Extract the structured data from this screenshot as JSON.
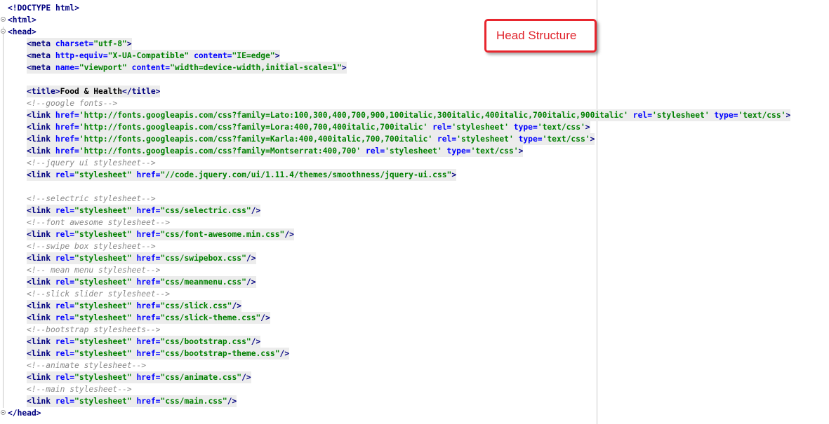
{
  "callout": {
    "label": "Head Structure",
    "border_color": "#e8262e",
    "text_color": "#e0242c"
  },
  "colors": {
    "tag": "#000080",
    "attribute": "#0000ff",
    "value": "#008000",
    "comment": "#8a8a8a",
    "current_line_bg": "#ececec"
  },
  "lines": [
    {
      "indent": 0,
      "fold": false,
      "highlight": false,
      "tokens": [
        [
          "doctype",
          "<!DOCTYPE "
        ],
        [
          "tag",
          "html"
        ],
        [
          "punc",
          ">"
        ]
      ]
    },
    {
      "indent": 0,
      "fold": true,
      "highlight": false,
      "tokens": [
        [
          "tag",
          "<html>"
        ]
      ]
    },
    {
      "indent": 0,
      "fold": true,
      "highlight": false,
      "tokens": [
        [
          "tag",
          "<head>"
        ]
      ]
    },
    {
      "indent": 1,
      "fold": false,
      "highlight": true,
      "tokens": [
        [
          "tag",
          "<meta "
        ],
        [
          "attr",
          "charset="
        ],
        [
          "val",
          "\"utf-8\""
        ],
        [
          "tag",
          ">"
        ]
      ]
    },
    {
      "indent": 1,
      "fold": false,
      "highlight": true,
      "tokens": [
        [
          "tag",
          "<meta "
        ],
        [
          "attr",
          "http-equiv="
        ],
        [
          "val",
          "\"X-UA-Compatible\""
        ],
        [
          "attr",
          " content="
        ],
        [
          "val",
          "\"IE=edge\""
        ],
        [
          "tag",
          ">"
        ]
      ]
    },
    {
      "indent": 1,
      "fold": false,
      "highlight": true,
      "tokens": [
        [
          "tag",
          "<meta "
        ],
        [
          "attr",
          "name="
        ],
        [
          "val",
          "\"viewport\""
        ],
        [
          "attr",
          " content="
        ],
        [
          "val",
          "\"width=device-width,initial-scale=1\""
        ],
        [
          "tag",
          ">"
        ]
      ]
    },
    {
      "indent": 1,
      "fold": false,
      "highlight": false,
      "tokens": []
    },
    {
      "indent": 1,
      "fold": false,
      "highlight": true,
      "tokens": [
        [
          "tag",
          "<title>"
        ],
        [
          "txt",
          "Food & Health"
        ],
        [
          "tag",
          "</title>"
        ]
      ]
    },
    {
      "indent": 1,
      "fold": false,
      "highlight": false,
      "tokens": [
        [
          "cmt",
          "<!--google fonts-->"
        ]
      ]
    },
    {
      "indent": 1,
      "fold": false,
      "highlight": true,
      "tokens": [
        [
          "tag",
          "<link "
        ],
        [
          "attr",
          "href="
        ],
        [
          "val",
          "'http://fonts.googleapis.com/css?family=Lato:100,300,400,700,900,100italic,300italic,400italic,700italic,900italic'"
        ],
        [
          "attr",
          " rel="
        ],
        [
          "val",
          "'stylesheet'"
        ],
        [
          "attr",
          " type="
        ],
        [
          "val",
          "'text/css'"
        ],
        [
          "tag",
          ">"
        ]
      ]
    },
    {
      "indent": 1,
      "fold": false,
      "highlight": true,
      "tokens": [
        [
          "tag",
          "<link "
        ],
        [
          "attr",
          "href="
        ],
        [
          "val",
          "'http://fonts.googleapis.com/css?family=Lora:400,700,400italic,700italic'"
        ],
        [
          "attr",
          " rel="
        ],
        [
          "val",
          "'stylesheet'"
        ],
        [
          "attr",
          " type="
        ],
        [
          "val",
          "'text/css'"
        ],
        [
          "tag",
          ">"
        ]
      ]
    },
    {
      "indent": 1,
      "fold": false,
      "highlight": true,
      "tokens": [
        [
          "tag",
          "<link "
        ],
        [
          "attr",
          "href="
        ],
        [
          "val",
          "'http://fonts.googleapis.com/css?family=Karla:400,400italic,700,700italic'"
        ],
        [
          "attr",
          " rel="
        ],
        [
          "val",
          "'stylesheet'"
        ],
        [
          "attr",
          " type="
        ],
        [
          "val",
          "'text/css'"
        ],
        [
          "tag",
          ">"
        ]
      ]
    },
    {
      "indent": 1,
      "fold": false,
      "highlight": true,
      "tokens": [
        [
          "tag",
          "<link "
        ],
        [
          "attr",
          "href="
        ],
        [
          "val",
          "'http://fonts.googleapis.com/css?family=Montserrat:400,700'"
        ],
        [
          "attr",
          " rel="
        ],
        [
          "val",
          "'stylesheet'"
        ],
        [
          "attr",
          " type="
        ],
        [
          "val",
          "'text/css'"
        ],
        [
          "tag",
          ">"
        ]
      ]
    },
    {
      "indent": 1,
      "fold": false,
      "highlight": false,
      "tokens": [
        [
          "cmt",
          "<!--jquery ui stylesheet-->"
        ]
      ]
    },
    {
      "indent": 1,
      "fold": false,
      "highlight": true,
      "tokens": [
        [
          "tag",
          "<link "
        ],
        [
          "attr",
          "rel="
        ],
        [
          "val",
          "\"stylesheet\""
        ],
        [
          "attr",
          " href="
        ],
        [
          "val",
          "\"//code.jquery.com/ui/1.11.4/themes/smoothness/jquery-ui.css\""
        ],
        [
          "tag",
          ">"
        ]
      ]
    },
    {
      "indent": 1,
      "fold": false,
      "highlight": false,
      "tokens": []
    },
    {
      "indent": 1,
      "fold": false,
      "highlight": false,
      "tokens": [
        [
          "cmt",
          "<!--selectric stylesheet-->"
        ]
      ]
    },
    {
      "indent": 1,
      "fold": false,
      "highlight": true,
      "tokens": [
        [
          "tag",
          "<link "
        ],
        [
          "attr",
          "rel="
        ],
        [
          "val",
          "\"stylesheet\""
        ],
        [
          "attr",
          " href="
        ],
        [
          "val",
          "\"css/selectric.css\""
        ],
        [
          "tag",
          "/>"
        ]
      ]
    },
    {
      "indent": 1,
      "fold": false,
      "highlight": false,
      "tokens": [
        [
          "cmt",
          "<!--font awesome stylesheet-->"
        ]
      ]
    },
    {
      "indent": 1,
      "fold": false,
      "highlight": true,
      "tokens": [
        [
          "tag",
          "<link "
        ],
        [
          "attr",
          "rel="
        ],
        [
          "val",
          "\"stylesheet\""
        ],
        [
          "attr",
          " href="
        ],
        [
          "val",
          "\"css/font-awesome.min.css\""
        ],
        [
          "tag",
          "/>"
        ]
      ]
    },
    {
      "indent": 1,
      "fold": false,
      "highlight": false,
      "tokens": [
        [
          "cmt",
          "<!--swipe box stylesheet-->"
        ]
      ]
    },
    {
      "indent": 1,
      "fold": false,
      "highlight": true,
      "tokens": [
        [
          "tag",
          "<link "
        ],
        [
          "attr",
          "rel="
        ],
        [
          "val",
          "\"stylesheet\""
        ],
        [
          "attr",
          " href="
        ],
        [
          "val",
          "\"css/swipebox.css\""
        ],
        [
          "tag",
          "/>"
        ]
      ]
    },
    {
      "indent": 1,
      "fold": false,
      "highlight": false,
      "tokens": [
        [
          "cmt",
          "<!-- mean menu stylesheet-->"
        ]
      ]
    },
    {
      "indent": 1,
      "fold": false,
      "highlight": true,
      "tokens": [
        [
          "tag",
          "<link "
        ],
        [
          "attr",
          "rel="
        ],
        [
          "val",
          "\"stylesheet\""
        ],
        [
          "attr",
          " href="
        ],
        [
          "val",
          "\"css/meanmenu.css\""
        ],
        [
          "tag",
          "/>"
        ]
      ]
    },
    {
      "indent": 1,
      "fold": false,
      "highlight": false,
      "tokens": [
        [
          "cmt",
          "<!--slick slider stylesheet-->"
        ]
      ]
    },
    {
      "indent": 1,
      "fold": false,
      "highlight": true,
      "tokens": [
        [
          "tag",
          "<link "
        ],
        [
          "attr",
          "rel="
        ],
        [
          "val",
          "\"stylesheet\""
        ],
        [
          "attr",
          " href="
        ],
        [
          "val",
          "\"css/slick.css\""
        ],
        [
          "tag",
          "/>"
        ]
      ]
    },
    {
      "indent": 1,
      "fold": false,
      "highlight": true,
      "tokens": [
        [
          "tag",
          "<link "
        ],
        [
          "attr",
          "rel="
        ],
        [
          "val",
          "\"stylesheet\""
        ],
        [
          "attr",
          " href="
        ],
        [
          "val",
          "\"css/slick-theme.css\""
        ],
        [
          "tag",
          "/>"
        ]
      ]
    },
    {
      "indent": 1,
      "fold": false,
      "highlight": false,
      "tokens": [
        [
          "cmt",
          "<!--bootstrap stylesheets-->"
        ]
      ]
    },
    {
      "indent": 1,
      "fold": false,
      "highlight": true,
      "tokens": [
        [
          "tag",
          "<link "
        ],
        [
          "attr",
          "rel="
        ],
        [
          "val",
          "\"stylesheet\""
        ],
        [
          "attr",
          " href="
        ],
        [
          "val",
          "\"css/bootstrap.css\""
        ],
        [
          "tag",
          "/>"
        ]
      ]
    },
    {
      "indent": 1,
      "fold": false,
      "highlight": true,
      "tokens": [
        [
          "tag",
          "<link "
        ],
        [
          "attr",
          "rel="
        ],
        [
          "val",
          "\"stylesheet\""
        ],
        [
          "attr",
          " href="
        ],
        [
          "val",
          "\"css/bootstrap-theme.css\""
        ],
        [
          "tag",
          "/>"
        ]
      ]
    },
    {
      "indent": 1,
      "fold": false,
      "highlight": false,
      "tokens": [
        [
          "cmt",
          "<!--animate stylesheet-->"
        ]
      ]
    },
    {
      "indent": 1,
      "fold": false,
      "highlight": true,
      "tokens": [
        [
          "tag",
          "<link "
        ],
        [
          "attr",
          "rel="
        ],
        [
          "val",
          "\"stylesheet\""
        ],
        [
          "attr",
          " href="
        ],
        [
          "val",
          "\"css/animate.css\""
        ],
        [
          "tag",
          "/>"
        ]
      ]
    },
    {
      "indent": 1,
      "fold": false,
      "highlight": false,
      "tokens": [
        [
          "cmt",
          "<!--main stylesheet-->"
        ]
      ]
    },
    {
      "indent": 1,
      "fold": false,
      "highlight": true,
      "tokens": [
        [
          "tag",
          "<link "
        ],
        [
          "attr",
          "rel="
        ],
        [
          "val",
          "\"stylesheet\""
        ],
        [
          "attr",
          " href="
        ],
        [
          "val",
          "\"css/main.css\""
        ],
        [
          "tag",
          "/>"
        ]
      ]
    },
    {
      "indent": 0,
      "fold": true,
      "highlight": false,
      "tokens": [
        [
          "tag",
          "</head>"
        ]
      ]
    }
  ]
}
